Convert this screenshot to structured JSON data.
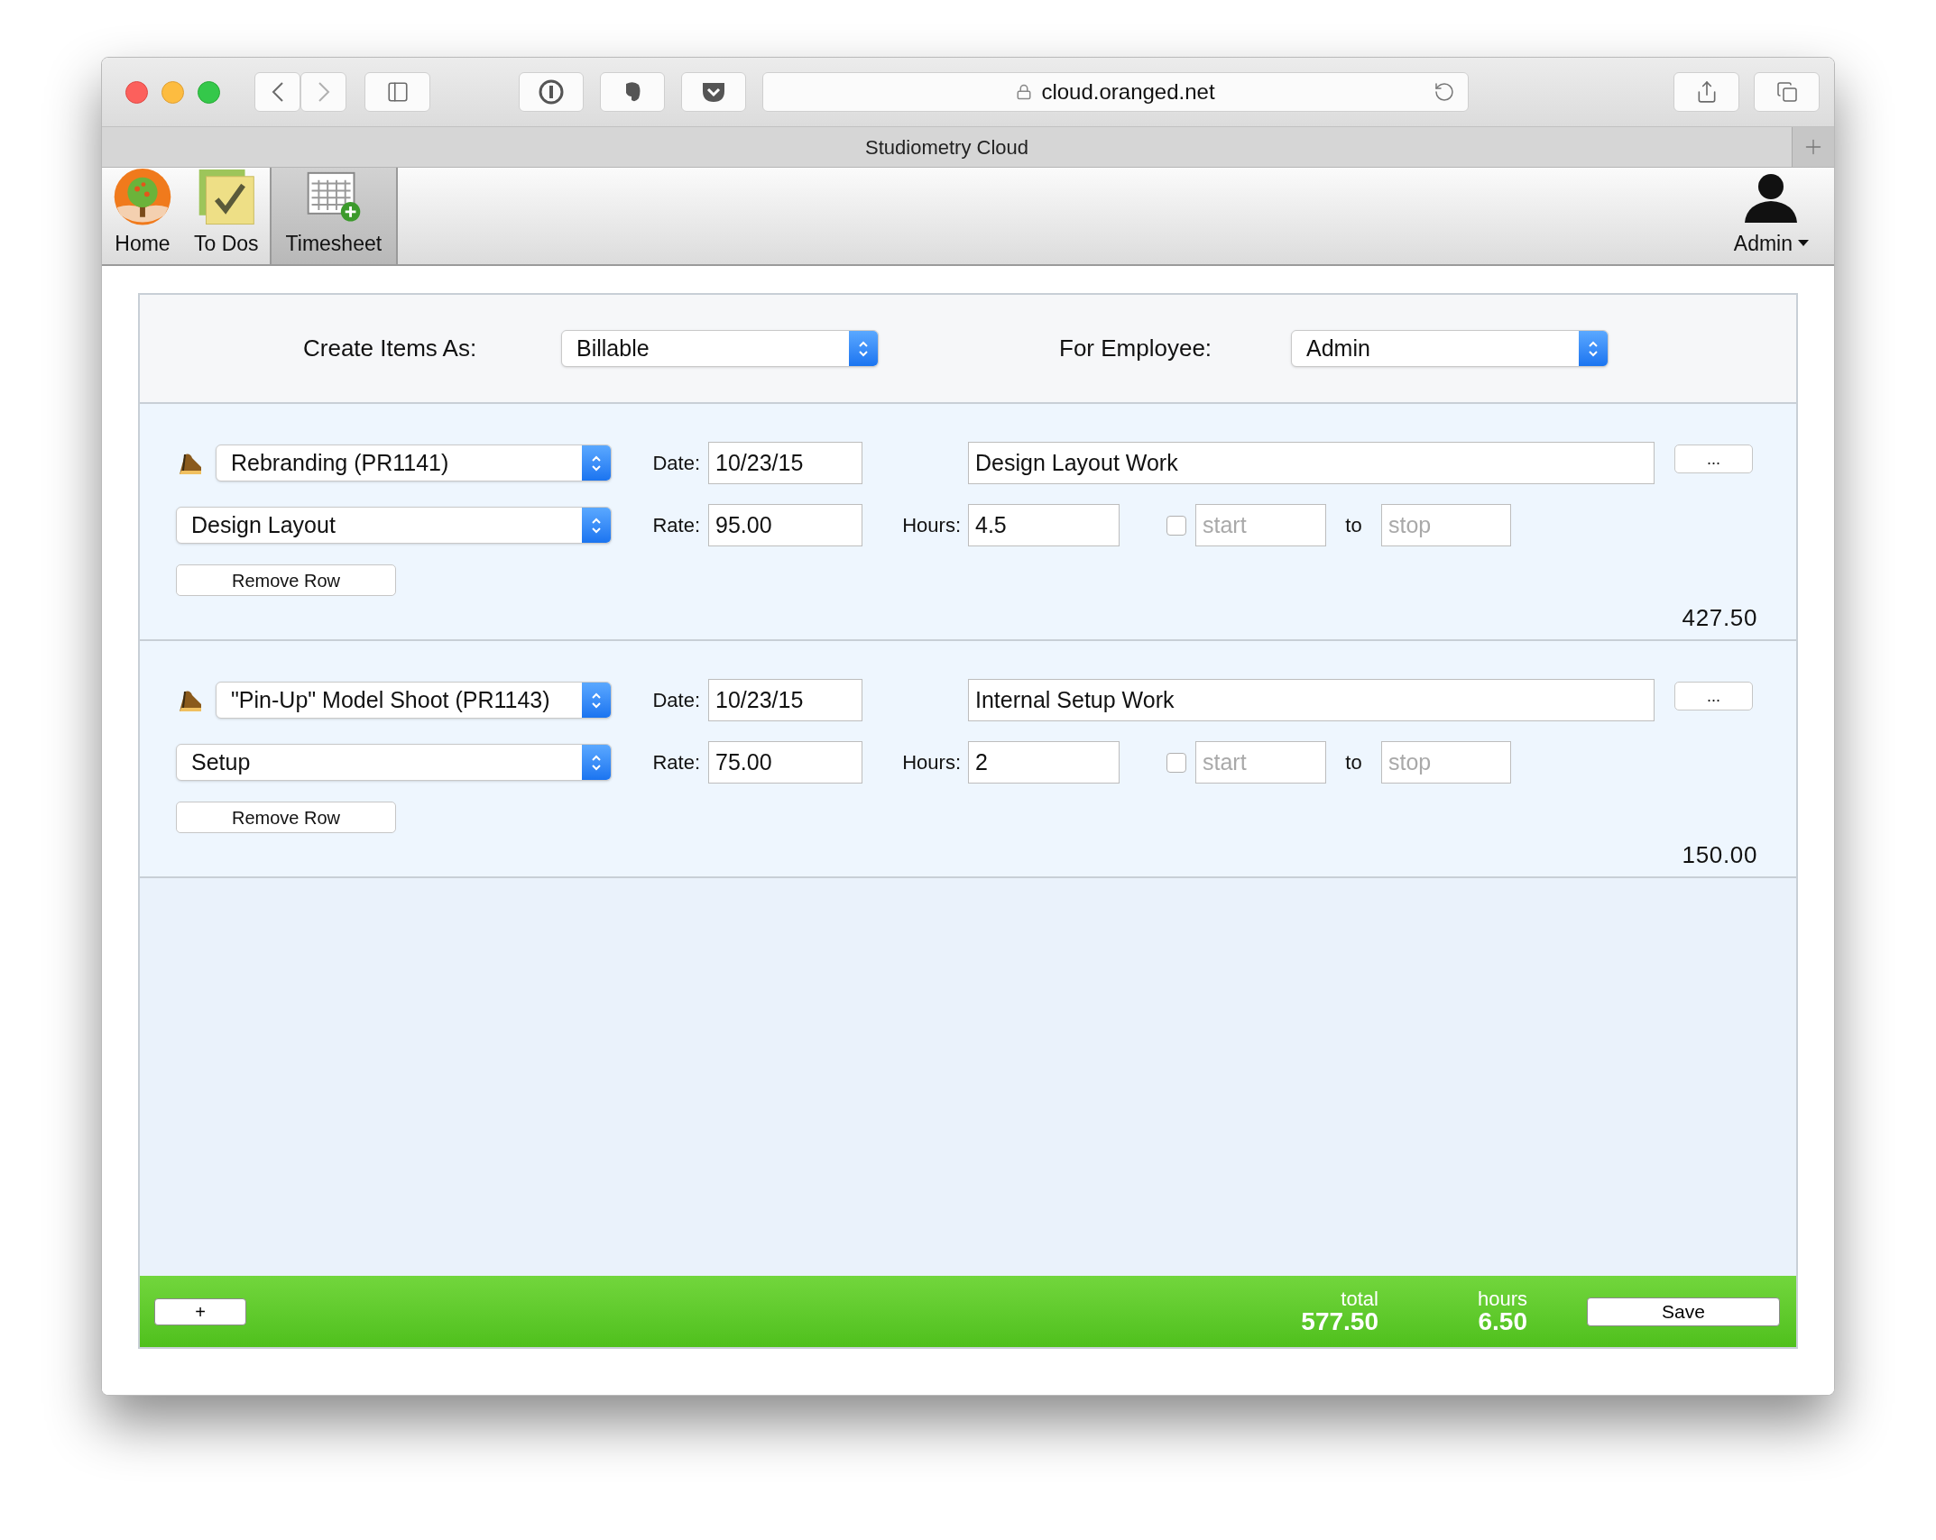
{
  "browser": {
    "url": "cloud.oranged.net",
    "tab_title": "Studiometry Cloud"
  },
  "nav": {
    "items": [
      {
        "label": "Home",
        "kind": "home",
        "selected": false
      },
      {
        "label": "To Dos",
        "kind": "todos",
        "selected": false
      },
      {
        "label": "Timesheet",
        "kind": "timesheet",
        "selected": true
      }
    ],
    "user": "Admin"
  },
  "settings": {
    "create_label": "Create Items As:",
    "create_value": "Billable",
    "employee_label": "For Employee:",
    "employee_value": "Admin"
  },
  "rows": [
    {
      "project": "Rebranding (PR1141)",
      "task": "Design Layout",
      "date_label": "Date:",
      "date": "10/23/15",
      "description": "Design Layout Work",
      "more": "...",
      "rate_label": "Rate:",
      "rate": "95.00",
      "hours_label": "Hours:",
      "hours": "4.5",
      "timer_checked": false,
      "start_placeholder": "start",
      "to": "to",
      "stop_placeholder": "stop",
      "remove": "Remove Row",
      "amount": "427.50"
    },
    {
      "project": "\"Pin-Up\" Model Shoot (PR1143)",
      "task": "Setup",
      "date_label": "Date:",
      "date": "10/23/15",
      "description": "Internal Setup Work",
      "more": "...",
      "rate_label": "Rate:",
      "rate": "75.00",
      "hours_label": "Hours:",
      "hours": "2",
      "timer_checked": false,
      "start_placeholder": "start",
      "to": "to",
      "stop_placeholder": "stop",
      "remove": "Remove Row",
      "amount": "150.00"
    }
  ],
  "footer": {
    "add": "+",
    "total_label": "total",
    "total": "577.50",
    "hours_label": "hours",
    "hours": "6.50",
    "save": "Save"
  }
}
